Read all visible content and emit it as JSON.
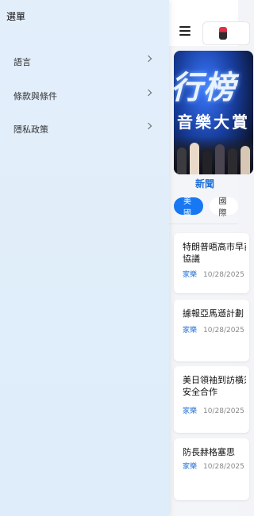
{
  "drawer": {
    "title": "選單",
    "items": [
      {
        "label": "語言",
        "icon": "chevron-right-icon"
      },
      {
        "label": "條款與條件",
        "icon": "chevron-right-icon"
      },
      {
        "label": "隱私政策",
        "icon": "chevron-right-icon"
      }
    ]
  },
  "app": {
    "menu_icon": "hamburger-icon",
    "banner": {
      "big_text": "行榜",
      "sub_text": "音樂大賞"
    },
    "section_title": "新聞",
    "tabs": [
      {
        "label": "美國",
        "active": true
      },
      {
        "label": "國際",
        "active": false
      }
    ],
    "articles": [
      {
        "title_line1": "特朗普晤高市早苗",
        "title_line2": "協議",
        "source": "家樂",
        "date": "10/28/2025"
      },
      {
        "title_line1": "據報亞馬遜計劃",
        "title_line2": "",
        "source": "家樂",
        "date": "10/28/2025"
      },
      {
        "title_line1": "美日領袖到訪橫須賀",
        "title_line2": "安全合作",
        "source": "家樂",
        "date": "10/28/2025"
      },
      {
        "title_line1": "防長赫格塞思",
        "title_line2": "",
        "source": "家樂",
        "date": "10/28/2025"
      }
    ],
    "colors": {
      "accent": "#1877f2",
      "link": "#1e6fd9",
      "drawer_bg": "#e3eefb"
    }
  }
}
